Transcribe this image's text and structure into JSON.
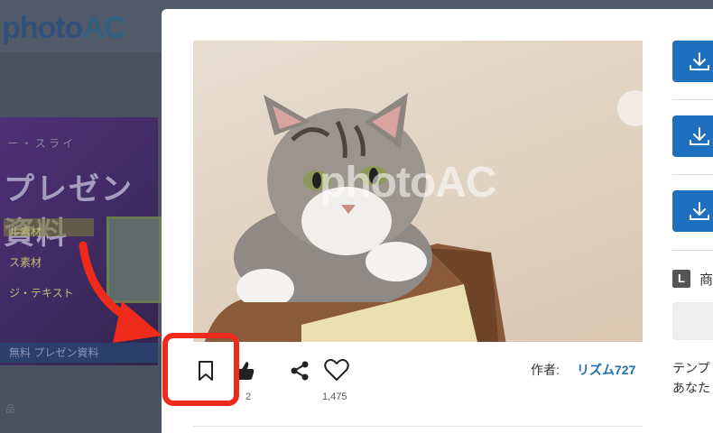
{
  "background": {
    "logo_text": "photo",
    "logo_ac": "AC",
    "banner_small": "ー ・ ス ラ イ",
    "banner_title": "プレゼン資料",
    "banner_lines": [
      "ル素材",
      "ス素材",
      "ジ・テキスト"
    ],
    "banner_footer": "無料 プレゼン資料",
    "bottom_text": "品"
  },
  "photo": {
    "watermark": "photoAC",
    "alt_subject": "cat"
  },
  "actions": {
    "like_count": "2",
    "favorite_count": "1,475",
    "author_label": "作者:",
    "author_name": "リズム727"
  },
  "sidebar": {
    "license_badge": "L",
    "license_text": "商",
    "description_line1": "テンプ",
    "description_line2": "あなた"
  },
  "icons": {
    "bookmark": "bookmark-icon",
    "like": "thumbs-up-icon",
    "share": "share-icon",
    "favorite": "heart-icon",
    "download": "download-icon"
  },
  "colors": {
    "download_button": "#1e6fbd",
    "author_link": "#1f6fb2",
    "annotation": "#ee2a1b"
  }
}
